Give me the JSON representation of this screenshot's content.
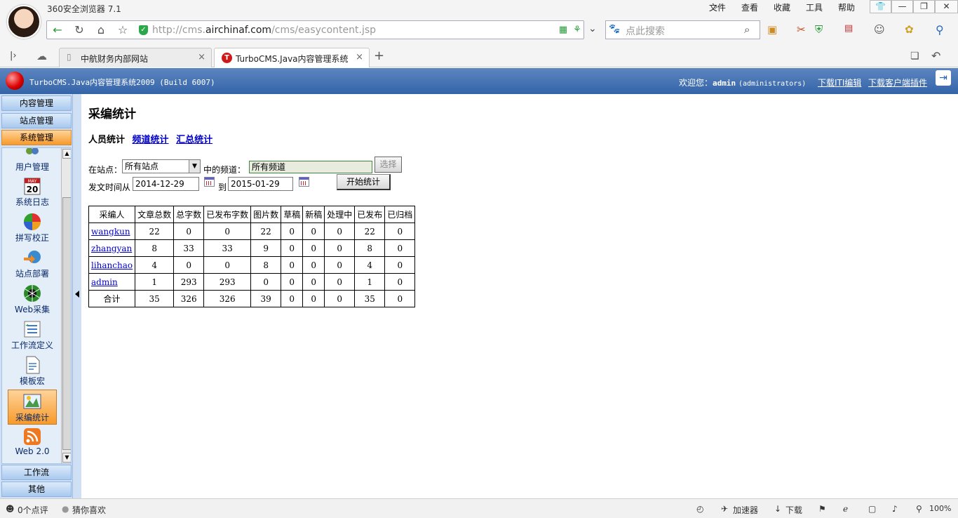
{
  "browser": {
    "title": "360安全浏览器 7.1",
    "menu": [
      "文件",
      "查看",
      "收藏",
      "工具",
      "帮助"
    ],
    "url_prefix": "http://cms.",
    "url_domain": "airchinaf.com",
    "url_path": "/cms/easycontent.jsp",
    "search_placeholder": "点此搜索",
    "tabs": [
      {
        "label": "中航财务内部网站",
        "active": false
      },
      {
        "label": "TurboCMS.Java内容管理系统",
        "active": true
      }
    ]
  },
  "header": {
    "title": "TurboCMS.Java内容管理系统2009 (Build 6007)",
    "welcome": "欢迎您：",
    "user": "admin",
    "role": "(administrators)",
    "link_editor": "下载ITI编辑",
    "link_plugin": "下载客户端插件"
  },
  "sidebar": {
    "groups_top": [
      "内容管理",
      "站点管理",
      "系统管理"
    ],
    "groups_bottom": [
      "工作流",
      "其他"
    ],
    "items": [
      {
        "label": "用户管理",
        "icon": "users-icon"
      },
      {
        "label": "系统日志",
        "icon": "calendar-icon",
        "icon_text": "20",
        "icon_month": "MAY"
      },
      {
        "label": "拼写校正",
        "icon": "spellcheck-icon"
      },
      {
        "label": "站点部署",
        "icon": "deploy-icon"
      },
      {
        "label": "Web采集",
        "icon": "spider-icon"
      },
      {
        "label": "工作流定义",
        "icon": "workflow-icon"
      },
      {
        "label": "模板宏",
        "icon": "template-icon"
      },
      {
        "label": "采编统计",
        "icon": "stats-icon",
        "active": true
      },
      {
        "label": "Web 2.0",
        "icon": "rss-icon"
      }
    ]
  },
  "main": {
    "title": "采编统计",
    "subnav": {
      "current": "人员统计",
      "links": [
        "频道统计",
        "汇总统计"
      ]
    },
    "form": {
      "site_label": "在站点：",
      "site_value": "所有站点",
      "channel_label": "中的频道：",
      "channel_value": "所有频道",
      "select_button": "选择",
      "date_from_label": "发文时间从",
      "date_from": "2014-12-29",
      "date_to_label": "到",
      "date_to": "2015-01-29",
      "start_button": "开始统计"
    },
    "table": {
      "headers": [
        "采编人",
        "文章总数",
        "总字数",
        "已发布字数",
        "图片数",
        "草稿",
        "新稿",
        "处理中",
        "已发布",
        "已归档"
      ],
      "rows": [
        [
          "wangkun",
          "22",
          "0",
          "0",
          "22",
          "0",
          "0",
          "0",
          "22",
          "0"
        ],
        [
          "zhangyan",
          "8",
          "33",
          "33",
          "9",
          "0",
          "0",
          "0",
          "8",
          "0"
        ],
        [
          "lihanchao",
          "4",
          "0",
          "0",
          "8",
          "0",
          "0",
          "0",
          "4",
          "0"
        ],
        [
          "admin",
          "1",
          "293",
          "293",
          "0",
          "0",
          "0",
          "0",
          "1",
          "0"
        ]
      ],
      "total": [
        "合计",
        "35",
        "326",
        "326",
        "39",
        "0",
        "0",
        "0",
        "35",
        "0"
      ]
    }
  },
  "statusbar": {
    "comments": "0个点评",
    "guess": "猜你喜欢",
    "accelerator": "加速器",
    "download": "下载",
    "zoom": "100%"
  }
}
